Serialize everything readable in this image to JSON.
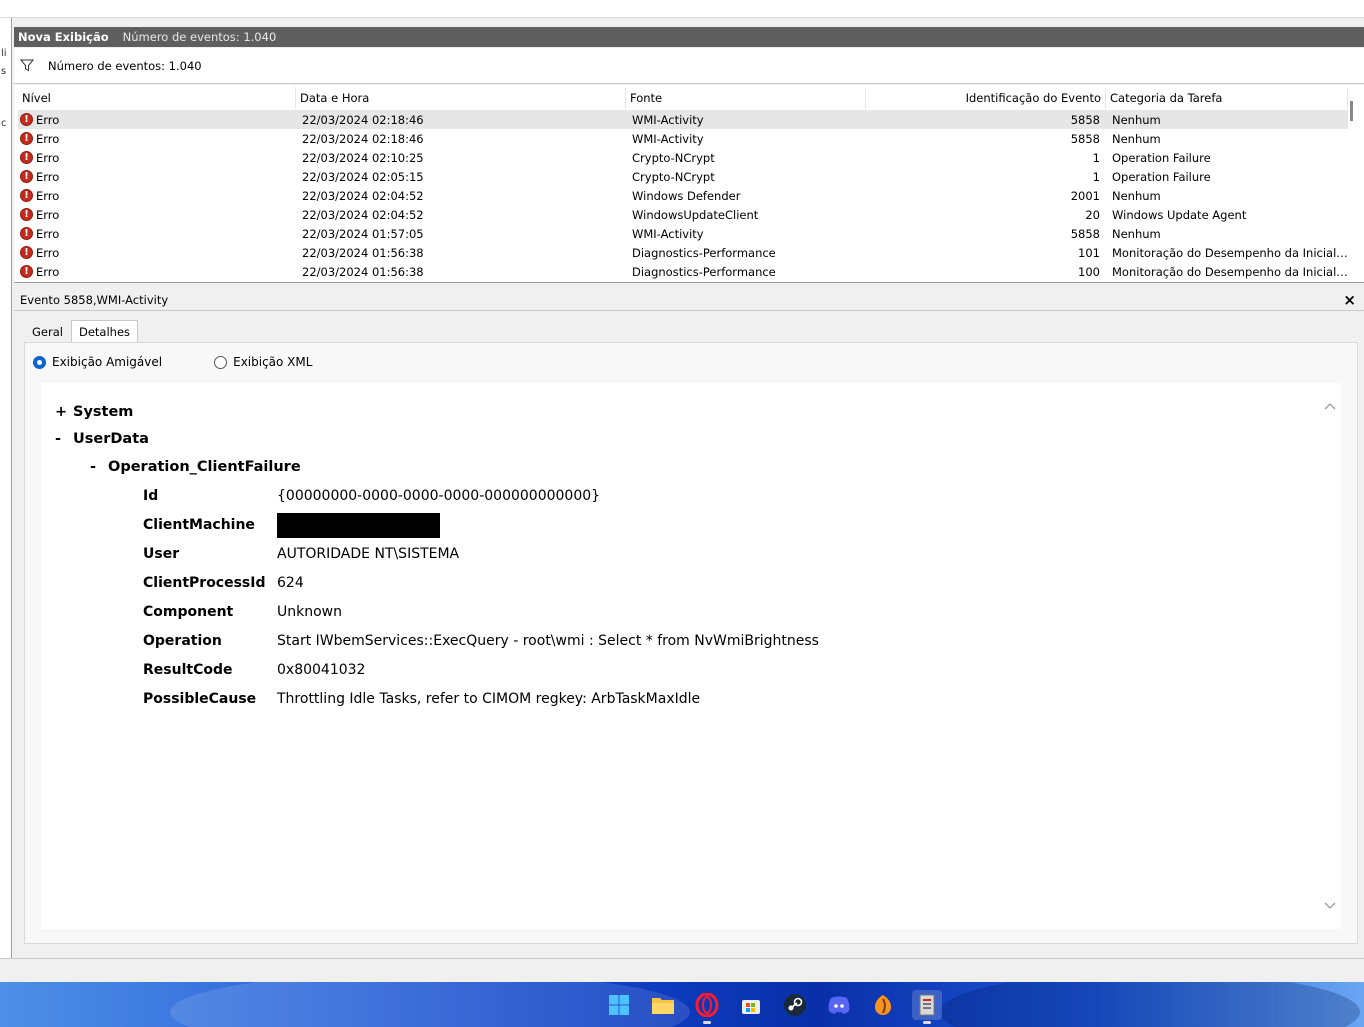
{
  "left_edge_chars": [
    "li",
    "s",
    "c"
  ],
  "view": {
    "title": "Nova Exibição",
    "count_label": "Número de eventos: 1.040"
  },
  "filter": {
    "label": "Número de eventos: 1.040"
  },
  "grid": {
    "columns": [
      "Nível",
      "Data e Hora",
      "Fonte",
      "Identificação do Evento",
      "Categoria da Tarefa"
    ],
    "rows": [
      {
        "level": "Erro",
        "datetime": "22/03/2024 02:18:46",
        "source": "WMI-Activity",
        "event_id": "5858",
        "category": "Nenhum",
        "selected": true
      },
      {
        "level": "Erro",
        "datetime": "22/03/2024 02:18:46",
        "source": "WMI-Activity",
        "event_id": "5858",
        "category": "Nenhum"
      },
      {
        "level": "Erro",
        "datetime": "22/03/2024 02:10:25",
        "source": "Crypto-NCrypt",
        "event_id": "1",
        "category": "Operation Failure"
      },
      {
        "level": "Erro",
        "datetime": "22/03/2024 02:05:15",
        "source": "Crypto-NCrypt",
        "event_id": "1",
        "category": "Operation Failure"
      },
      {
        "level": "Erro",
        "datetime": "22/03/2024 02:04:52",
        "source": "Windows Defender",
        "event_id": "2001",
        "category": "Nenhum"
      },
      {
        "level": "Erro",
        "datetime": "22/03/2024 02:04:52",
        "source": "WindowsUpdateClient",
        "event_id": "20",
        "category": "Windows Update Agent"
      },
      {
        "level": "Erro",
        "datetime": "22/03/2024 01:57:05",
        "source": "WMI-Activity",
        "event_id": "5858",
        "category": "Nenhum"
      },
      {
        "level": "Erro",
        "datetime": "22/03/2024 01:56:38",
        "source": "Diagnostics-Performance",
        "event_id": "101",
        "category": "Monitoração do Desempenho da Inicializ..."
      },
      {
        "level": "Erro",
        "datetime": "22/03/2024 01:56:38",
        "source": "Diagnostics-Performance",
        "event_id": "100",
        "category": "Monitoração do Desempenho da Inicializ..."
      }
    ]
  },
  "detail": {
    "title": "Evento 5858,WMI-Activity",
    "close_symbol": "×",
    "tabs": [
      "Geral",
      "Detalhes"
    ],
    "radio_friendly": "Exibição Amigável",
    "radio_xml": "Exibição XML",
    "tree": {
      "system": {
        "sym": "+",
        "label": "System"
      },
      "userdata": {
        "sym": "-",
        "label": "UserData"
      },
      "operation": {
        "sym": "-",
        "label": "Operation_ClientFailure"
      }
    },
    "fields": {
      "id": {
        "key": "Id",
        "value": "{00000000-0000-0000-0000-000000000000}"
      },
      "machine": {
        "key": "ClientMachine",
        "value": ""
      },
      "user": {
        "key": "User",
        "value": "AUTORIDADE NT\\SISTEMA"
      },
      "pid": {
        "key": "ClientProcessId",
        "value": "624"
      },
      "component": {
        "key": "Component",
        "value": "Unknown"
      },
      "operation": {
        "key": "Operation",
        "value": "Start IWbemServices::ExecQuery - root\\wmi : Select * from NvWmiBrightness"
      },
      "resultcode": {
        "key": "ResultCode",
        "value": "0x80041032"
      },
      "cause": {
        "key": "PossibleCause",
        "value": "Throttling Idle Tasks, refer to CIMOM regkey: ArbTaskMaxIdle"
      }
    }
  },
  "taskbar": {
    "icons": [
      "windows-start-icon",
      "file-explorer-icon",
      "opera-icon",
      "microsoft-store-icon",
      "steam-icon",
      "discord-icon",
      "fl-studio-icon",
      "event-viewer-icon"
    ]
  },
  "colors": {
    "title_bar": "#5f5f5f",
    "error_red": "#c42b1c",
    "radio_blue": "#0a64d0",
    "taskbar_blue": "#0e3fc4"
  }
}
